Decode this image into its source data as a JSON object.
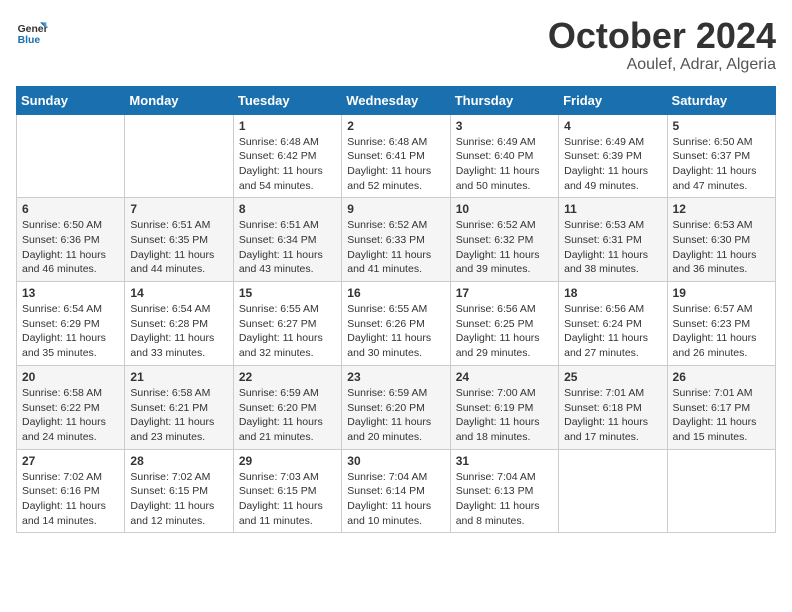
{
  "logo": {
    "text_general": "General",
    "text_blue": "Blue"
  },
  "header": {
    "month": "October 2024",
    "location": "Aoulef, Adrar, Algeria"
  },
  "weekdays": [
    "Sunday",
    "Monday",
    "Tuesday",
    "Wednesday",
    "Thursday",
    "Friday",
    "Saturday"
  ],
  "weeks": [
    [
      {
        "day": "",
        "info": ""
      },
      {
        "day": "",
        "info": ""
      },
      {
        "day": "1",
        "info": "Sunrise: 6:48 AM\nSunset: 6:42 PM\nDaylight: 11 hours and 54 minutes."
      },
      {
        "day": "2",
        "info": "Sunrise: 6:48 AM\nSunset: 6:41 PM\nDaylight: 11 hours and 52 minutes."
      },
      {
        "day": "3",
        "info": "Sunrise: 6:49 AM\nSunset: 6:40 PM\nDaylight: 11 hours and 50 minutes."
      },
      {
        "day": "4",
        "info": "Sunrise: 6:49 AM\nSunset: 6:39 PM\nDaylight: 11 hours and 49 minutes."
      },
      {
        "day": "5",
        "info": "Sunrise: 6:50 AM\nSunset: 6:37 PM\nDaylight: 11 hours and 47 minutes."
      }
    ],
    [
      {
        "day": "6",
        "info": "Sunrise: 6:50 AM\nSunset: 6:36 PM\nDaylight: 11 hours and 46 minutes."
      },
      {
        "day": "7",
        "info": "Sunrise: 6:51 AM\nSunset: 6:35 PM\nDaylight: 11 hours and 44 minutes."
      },
      {
        "day": "8",
        "info": "Sunrise: 6:51 AM\nSunset: 6:34 PM\nDaylight: 11 hours and 43 minutes."
      },
      {
        "day": "9",
        "info": "Sunrise: 6:52 AM\nSunset: 6:33 PM\nDaylight: 11 hours and 41 minutes."
      },
      {
        "day": "10",
        "info": "Sunrise: 6:52 AM\nSunset: 6:32 PM\nDaylight: 11 hours and 39 minutes."
      },
      {
        "day": "11",
        "info": "Sunrise: 6:53 AM\nSunset: 6:31 PM\nDaylight: 11 hours and 38 minutes."
      },
      {
        "day": "12",
        "info": "Sunrise: 6:53 AM\nSunset: 6:30 PM\nDaylight: 11 hours and 36 minutes."
      }
    ],
    [
      {
        "day": "13",
        "info": "Sunrise: 6:54 AM\nSunset: 6:29 PM\nDaylight: 11 hours and 35 minutes."
      },
      {
        "day": "14",
        "info": "Sunrise: 6:54 AM\nSunset: 6:28 PM\nDaylight: 11 hours and 33 minutes."
      },
      {
        "day": "15",
        "info": "Sunrise: 6:55 AM\nSunset: 6:27 PM\nDaylight: 11 hours and 32 minutes."
      },
      {
        "day": "16",
        "info": "Sunrise: 6:55 AM\nSunset: 6:26 PM\nDaylight: 11 hours and 30 minutes."
      },
      {
        "day": "17",
        "info": "Sunrise: 6:56 AM\nSunset: 6:25 PM\nDaylight: 11 hours and 29 minutes."
      },
      {
        "day": "18",
        "info": "Sunrise: 6:56 AM\nSunset: 6:24 PM\nDaylight: 11 hours and 27 minutes."
      },
      {
        "day": "19",
        "info": "Sunrise: 6:57 AM\nSunset: 6:23 PM\nDaylight: 11 hours and 26 minutes."
      }
    ],
    [
      {
        "day": "20",
        "info": "Sunrise: 6:58 AM\nSunset: 6:22 PM\nDaylight: 11 hours and 24 minutes."
      },
      {
        "day": "21",
        "info": "Sunrise: 6:58 AM\nSunset: 6:21 PM\nDaylight: 11 hours and 23 minutes."
      },
      {
        "day": "22",
        "info": "Sunrise: 6:59 AM\nSunset: 6:20 PM\nDaylight: 11 hours and 21 minutes."
      },
      {
        "day": "23",
        "info": "Sunrise: 6:59 AM\nSunset: 6:20 PM\nDaylight: 11 hours and 20 minutes."
      },
      {
        "day": "24",
        "info": "Sunrise: 7:00 AM\nSunset: 6:19 PM\nDaylight: 11 hours and 18 minutes."
      },
      {
        "day": "25",
        "info": "Sunrise: 7:01 AM\nSunset: 6:18 PM\nDaylight: 11 hours and 17 minutes."
      },
      {
        "day": "26",
        "info": "Sunrise: 7:01 AM\nSunset: 6:17 PM\nDaylight: 11 hours and 15 minutes."
      }
    ],
    [
      {
        "day": "27",
        "info": "Sunrise: 7:02 AM\nSunset: 6:16 PM\nDaylight: 11 hours and 14 minutes."
      },
      {
        "day": "28",
        "info": "Sunrise: 7:02 AM\nSunset: 6:15 PM\nDaylight: 11 hours and 12 minutes."
      },
      {
        "day": "29",
        "info": "Sunrise: 7:03 AM\nSunset: 6:15 PM\nDaylight: 11 hours and 11 minutes."
      },
      {
        "day": "30",
        "info": "Sunrise: 7:04 AM\nSunset: 6:14 PM\nDaylight: 11 hours and 10 minutes."
      },
      {
        "day": "31",
        "info": "Sunrise: 7:04 AM\nSunset: 6:13 PM\nDaylight: 11 hours and 8 minutes."
      },
      {
        "day": "",
        "info": ""
      },
      {
        "day": "",
        "info": ""
      }
    ]
  ]
}
